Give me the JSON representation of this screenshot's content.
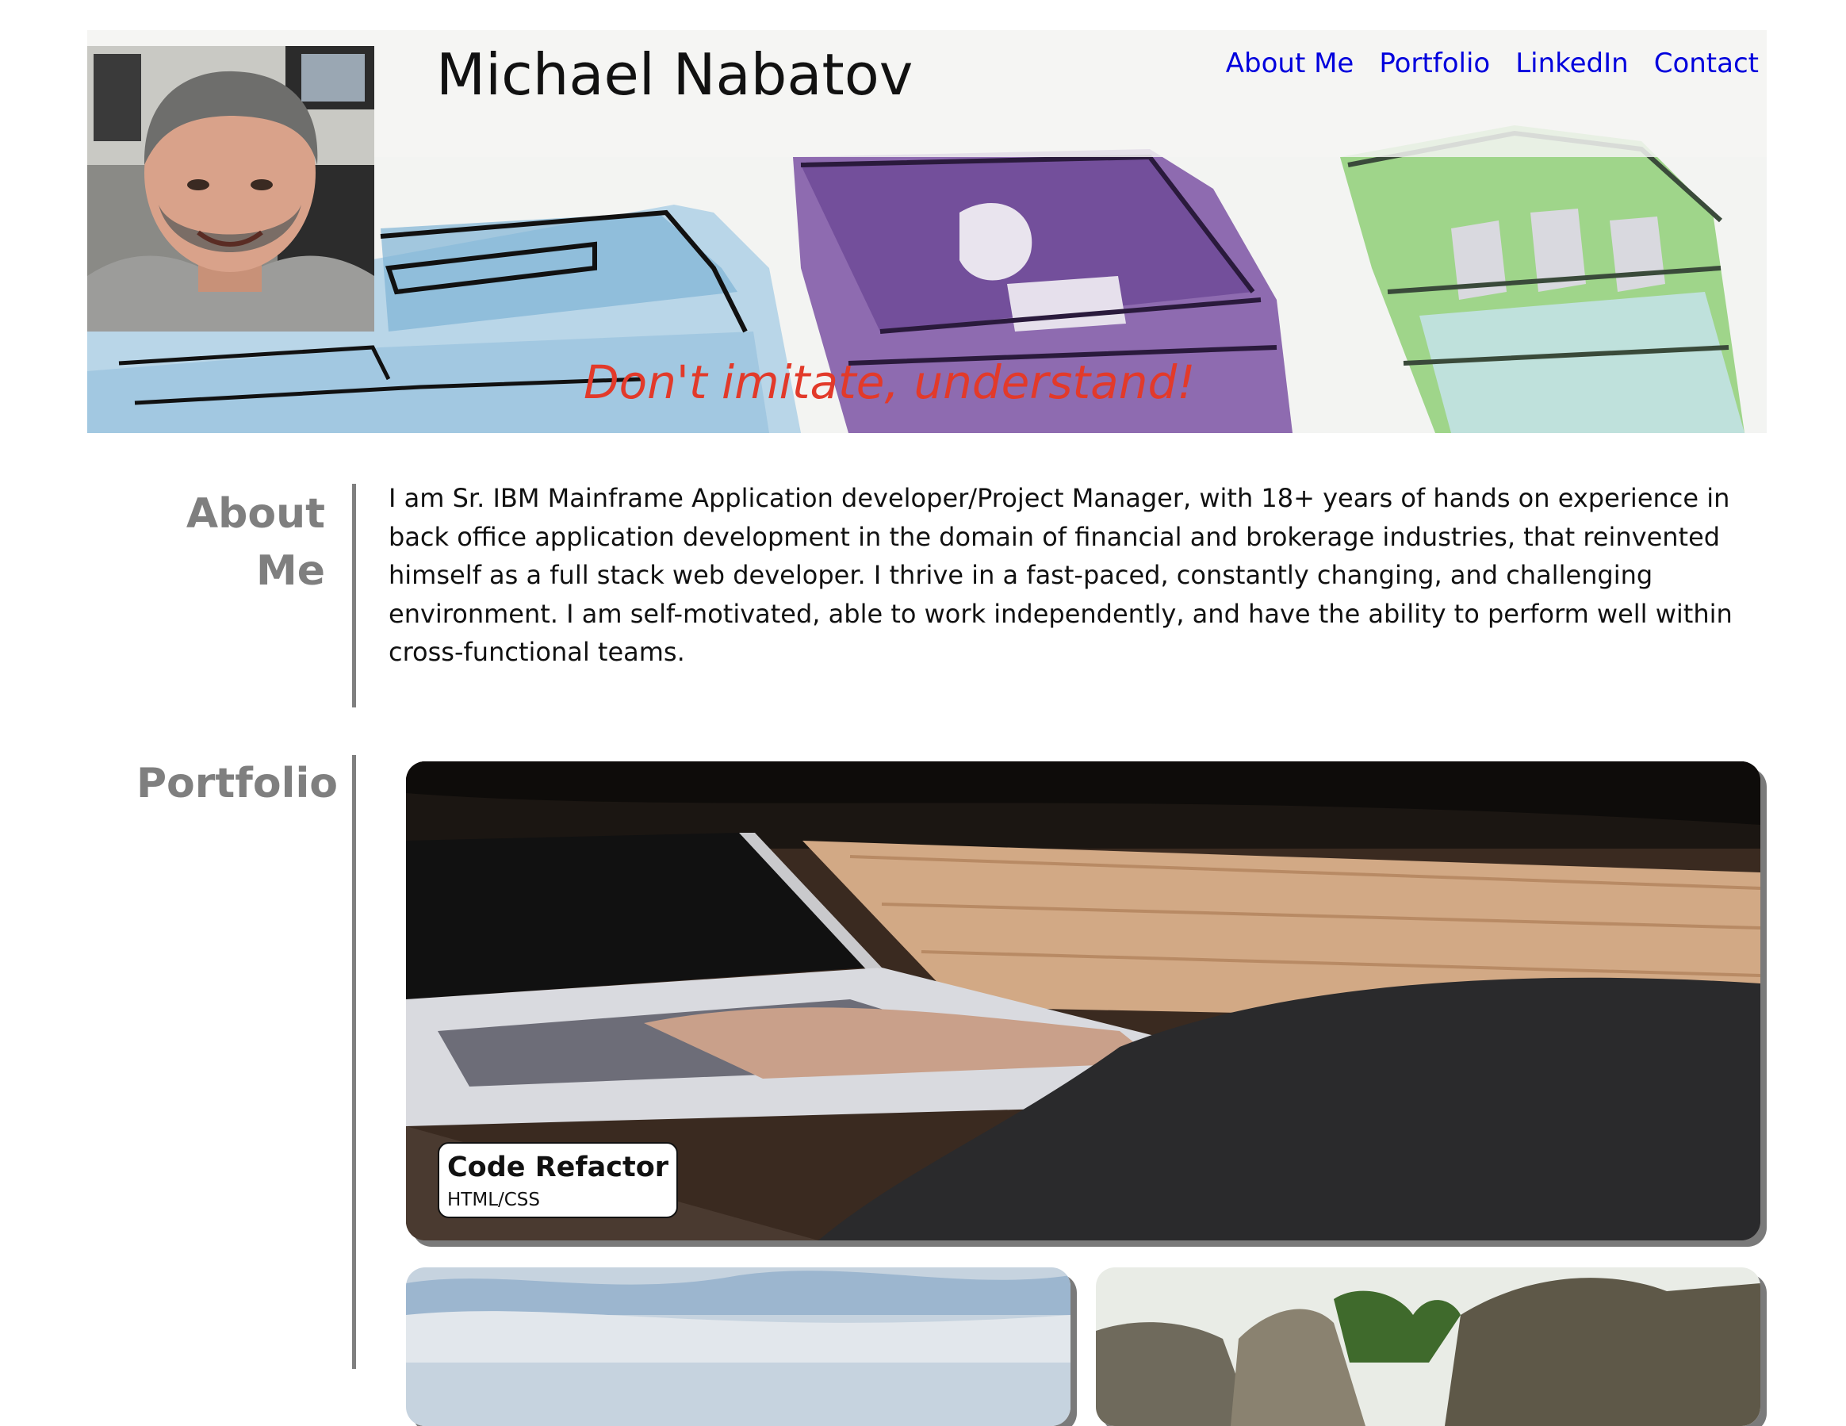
{
  "header": {
    "name": "Michael Nabatov",
    "tagline": "Don't imitate, understand!",
    "nav": [
      {
        "label": "About Me"
      },
      {
        "label": "Portfolio"
      },
      {
        "label": "LinkedIn"
      },
      {
        "label": "Contact"
      }
    ]
  },
  "about": {
    "heading_line1": "About",
    "heading_line2": "Me",
    "body": "I am Sr. IBM Mainframe Application developer/Project Manager, with 18+ years of hands on experience in back office application development in the domain of financial and brokerage industries, that reinvented himself as a full stack web developer. I thrive in a fast-paced, constantly changing, and challenging environment. I am self-motivated, able to work independently, and have the ability to perform well within cross-functional teams."
  },
  "portfolio": {
    "heading": "Portfolio",
    "projects": [
      {
        "title": "Code Refactor",
        "tech": "HTML/CSS"
      }
    ]
  },
  "colors": {
    "nav_link": "#0000dd",
    "tagline": "#e23a2a",
    "section_heading": "#7f7f7f"
  }
}
